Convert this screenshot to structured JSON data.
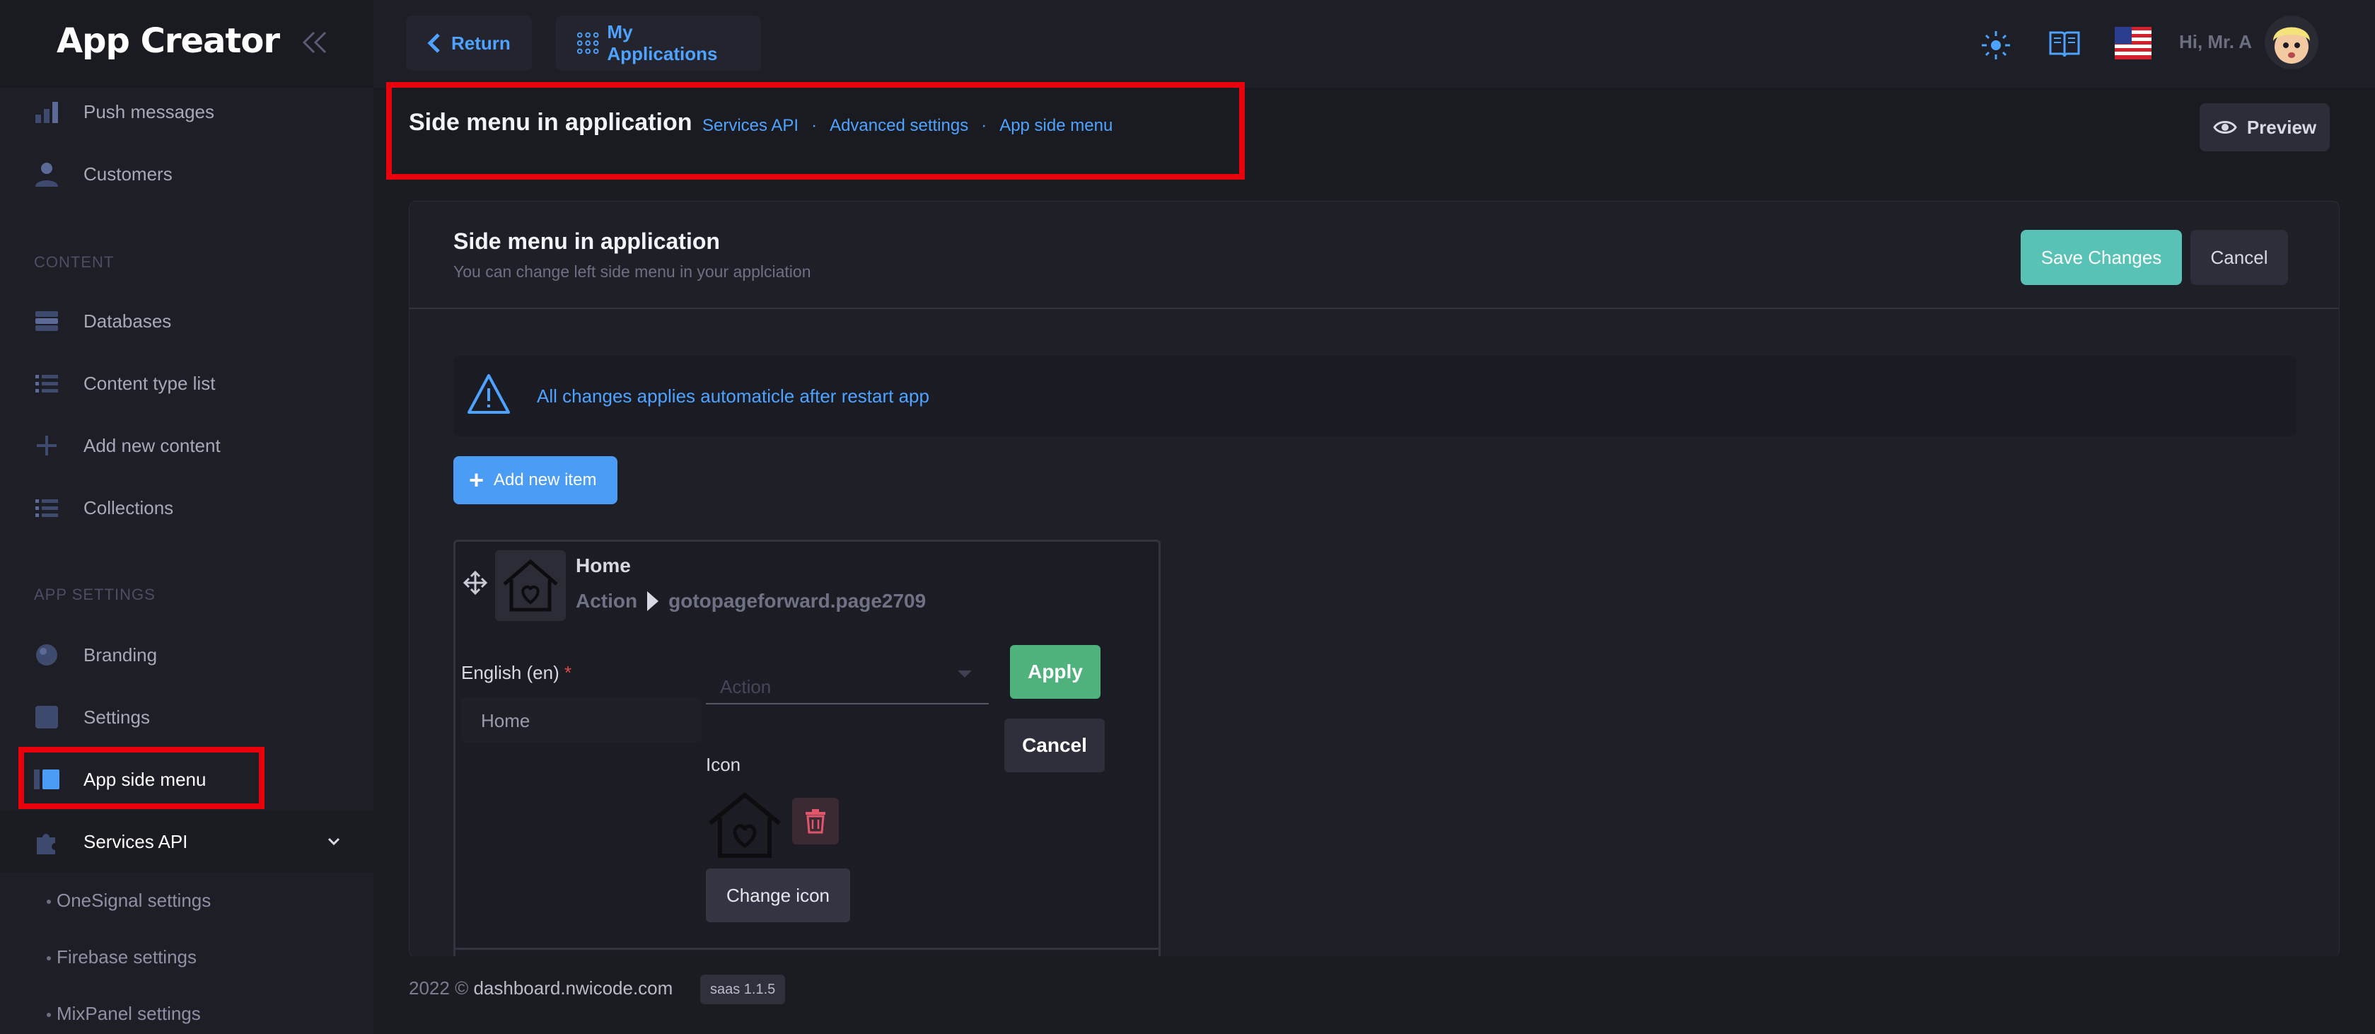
{
  "app": {
    "title": "App Creator"
  },
  "sidebar": {
    "items_top": [
      {
        "label": "Push messages"
      },
      {
        "label": "Customers"
      }
    ],
    "section_content": "CONTENT",
    "content_items": [
      {
        "label": "Databases"
      },
      {
        "label": "Content type list"
      },
      {
        "label": "Add new content"
      },
      {
        "label": "Collections"
      }
    ],
    "section_app_settings": "APP SETTINGS",
    "settings_items": [
      {
        "label": "Branding"
      },
      {
        "label": "Settings"
      },
      {
        "label": "App side menu"
      },
      {
        "label": "Services API"
      }
    ],
    "sub_items": [
      {
        "label": "OneSignal settings"
      },
      {
        "label": "Firebase settings"
      },
      {
        "label": "MixPanel settings"
      }
    ]
  },
  "topbar": {
    "return_label": "Return",
    "my_apps_label": "My Applications",
    "greeting": "Hi, Mr. A"
  },
  "subheader": {
    "title": "Side menu in application",
    "breadcrumb": [
      "Services API",
      "Advanced settings",
      "App side menu"
    ],
    "preview_label": "Preview"
  },
  "card": {
    "title": "Side menu in application",
    "subtitle": "You can change left side menu in your applciation",
    "save_label": "Save Changes",
    "cancel_label": "Cancel",
    "notice": "All changes applies automaticle after restart app",
    "add_item_label": "Add new item"
  },
  "menu_item": {
    "name": "Home",
    "action_word": "Action",
    "action_target": "gotopageforward.page2709",
    "lang_label": "English (en)",
    "required_mark": "*",
    "lang_value": "Home",
    "action_placeholder": "Action",
    "apply_label": "Apply",
    "cancel_label": "Cancel",
    "icon_label": "Icon",
    "change_icon_label": "Change icon"
  },
  "footer": {
    "copyright": "2022 ©",
    "domain": "dashboard.nwicode.com",
    "version": "saas 1.1.5"
  },
  "colors": {
    "accent": "#4da3ff",
    "save": "#58c2b6",
    "apply": "#4fb27d",
    "highlight": "#e8000b"
  }
}
